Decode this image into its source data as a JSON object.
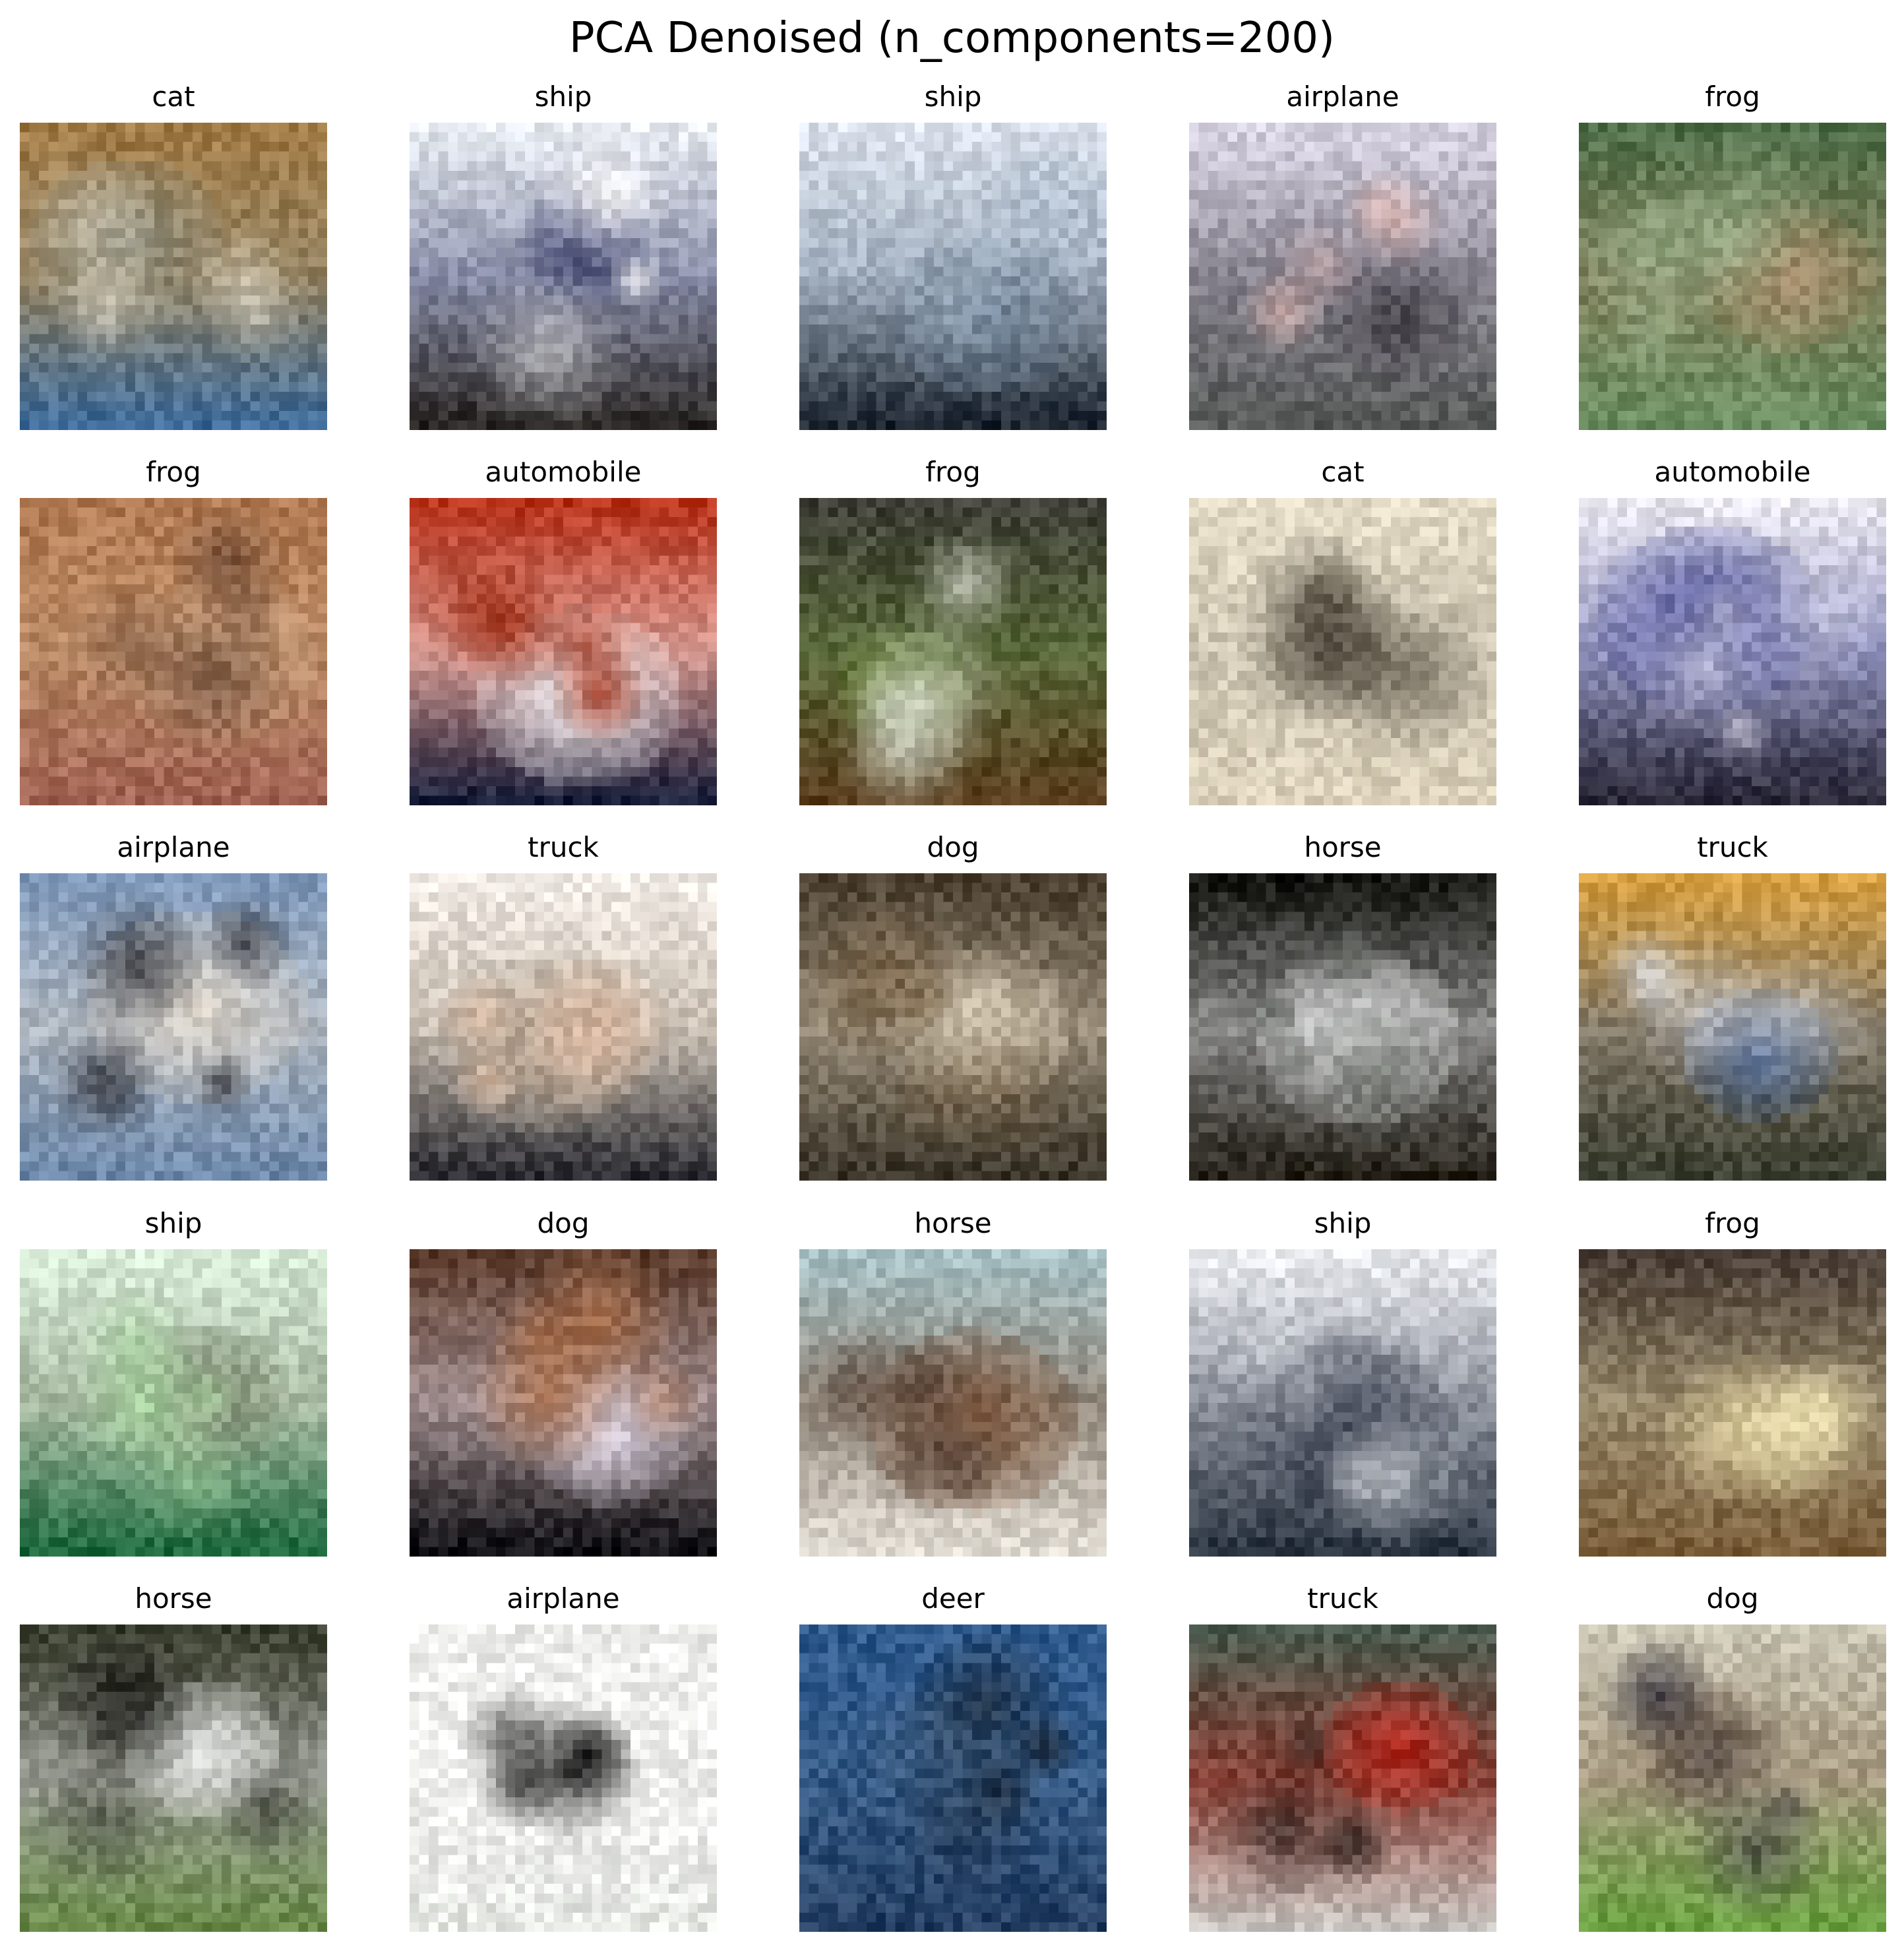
{
  "title": "PCA Denoised (n_components=200)",
  "grid": {
    "rows": 5,
    "cols": 5
  },
  "images": [
    {
      "label": "cat",
      "colors": {
        "top": "#a07a45",
        "mid": "#8a8a7a",
        "bottom": "#3e6b9a",
        "accent": "#e6e0d0"
      }
    },
    {
      "label": "ship",
      "colors": {
        "top": "#e8ecf2",
        "mid": "#3a3f6a",
        "bottom": "#2a2624",
        "accent": "#ffffff"
      }
    },
    {
      "label": "ship",
      "colors": {
        "top": "#dde3ee",
        "mid": "#6f8296",
        "bottom": "#1c2530",
        "accent": "#a8b8c8"
      }
    },
    {
      "label": "airplane",
      "colors": {
        "top": "#d8d4e4",
        "mid": "#46424a",
        "bottom": "#575a58",
        "accent": "#e0b6b0"
      }
    },
    {
      "label": "frog",
      "colors": {
        "top": "#4e6e48",
        "mid": "#a88e6c",
        "bottom": "#6a8e60",
        "accent": "#9ab28c"
      }
    },
    {
      "label": "frog",
      "colors": {
        "top": "#b07850",
        "mid": "#c29a78",
        "bottom": "#a06252",
        "accent": "#5a3a2a"
      }
    },
    {
      "label": "automobile",
      "colors": {
        "top": "#b8321a",
        "mid": "#f0f0f4",
        "bottom": "#1a1f3a",
        "accent": "#a03018"
      }
    },
    {
      "label": "frog",
      "colors": {
        "top": "#3e3e36",
        "mid": "#6e8a3c",
        "bottom": "#5a3e1e",
        "accent": "#d8dccf"
      }
    },
    {
      "label": "cat",
      "colors": {
        "top": "#e2dac4",
        "mid": "#bcb4a2",
        "bottom": "#dcd2bc",
        "accent": "#3a3328"
      }
    },
    {
      "label": "automobile",
      "colors": {
        "top": "#e8e6ee",
        "mid": "#4a4e96",
        "bottom": "#2a2838",
        "accent": "#c8c6da"
      }
    },
    {
      "label": "airplane",
      "colors": {
        "top": "#7e98ba",
        "mid": "#d8d0c4",
        "bottom": "#6a86a8",
        "accent": "#2a2a30"
      }
    },
    {
      "label": "truck",
      "colors": {
        "top": "#f2ece6",
        "mid": "#a89a88",
        "bottom": "#2a2a30",
        "accent": "#d8b8a2"
      }
    },
    {
      "label": "dog",
      "colors": {
        "top": "#4a3e2e",
        "mid": "#d8ccb6",
        "bottom": "#3a3428",
        "accent": "#7a6448"
      }
    },
    {
      "label": "horse",
      "colors": {
        "top": "#161612",
        "mid": "#e8e8ea",
        "bottom": "#26221a",
        "accent": "#5a6058"
      }
    },
    {
      "label": "truck",
      "colors": {
        "top": "#d8a040",
        "mid": "#3e5a8a",
        "bottom": "#3a3e30",
        "accent": "#d8dce4"
      }
    },
    {
      "label": "ship",
      "colors": {
        "top": "#d8ecd8",
        "mid": "#7e8c72",
        "bottom": "#1e6a3e",
        "accent": "#a8d6a0"
      }
    },
    {
      "label": "dog",
      "colors": {
        "top": "#5a3a2a",
        "mid": "#e0d8e8",
        "bottom": "#101014",
        "accent": "#b07048"
      }
    },
    {
      "label": "horse",
      "colors": {
        "top": "#a8c2c6",
        "mid": "#7a5238",
        "bottom": "#e2ddd4",
        "accent": "#5a463a"
      }
    },
    {
      "label": "ship",
      "colors": {
        "top": "#eceef2",
        "mid": "#3a4050",
        "bottom": "#2a3440",
        "accent": "#c8ccd2"
      }
    },
    {
      "label": "frog",
      "colors": {
        "top": "#4a3e36",
        "mid": "#d8c898",
        "bottom": "#7a5e3a",
        "accent": "#ece0b0"
      }
    },
    {
      "label": "horse",
      "colors": {
        "top": "#3a3e2e",
        "mid": "#e8eae8",
        "bottom": "#6a8a4a",
        "accent": "#1a1a16"
      }
    },
    {
      "label": "airplane",
      "colors": {
        "top": "#eeeeec",
        "mid": "#f4f4f2",
        "bottom": "#e6e8e4",
        "accent": "#141414"
      }
    },
    {
      "label": "deer",
      "colors": {
        "top": "#2e5a8e",
        "mid": "#3a5a7e",
        "bottom": "#243e62",
        "accent": "#1a2430"
      }
    },
    {
      "label": "truck",
      "colors": {
        "top": "#4a5a4e",
        "mid": "#b8281e",
        "bottom": "#c8c4c0",
        "accent": "#2a1e1a"
      }
    },
    {
      "label": "dog",
      "colors": {
        "top": "#c8c4b2",
        "mid": "#8a7456",
        "bottom": "#6aa040",
        "accent": "#3a3640"
      }
    }
  ]
}
